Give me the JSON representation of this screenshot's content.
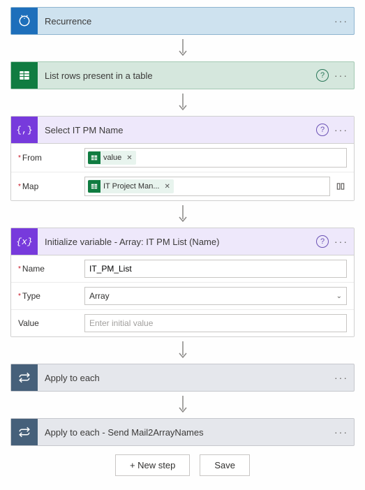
{
  "steps": {
    "recurrence": {
      "title": "Recurrence"
    },
    "listRows": {
      "title": "List rows present in a table"
    },
    "select": {
      "title": "Select IT PM Name",
      "fromLabel": "From",
      "fromToken": "value",
      "mapLabel": "Map",
      "mapToken": "IT Project Man..."
    },
    "initVar": {
      "title": "Initialize variable - Array: IT PM List (Name)",
      "nameLabel": "Name",
      "nameValue": "IT_PM_List",
      "typeLabel": "Type",
      "typeValue": "Array",
      "valueLabel": "Value",
      "valuePlaceholder": "Enter initial value"
    },
    "apply1": {
      "title": "Apply to each"
    },
    "apply2": {
      "title": "Apply to each - Send Mail2ArrayNames"
    }
  },
  "buttons": {
    "newStep": "+ New step",
    "save": "Save"
  }
}
